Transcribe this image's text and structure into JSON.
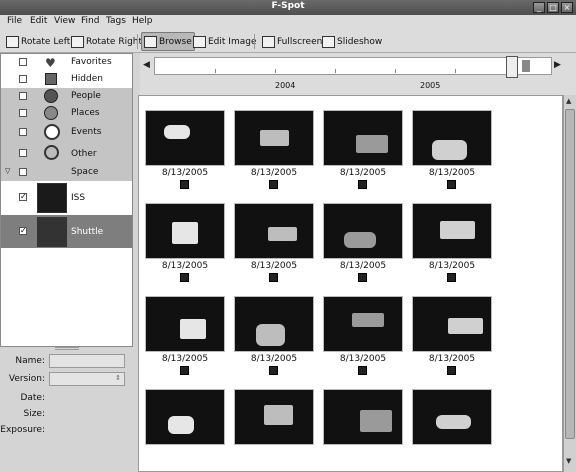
{
  "window": {
    "title": "F-Spot"
  },
  "menubar": [
    "File",
    "Edit",
    "View",
    "Find",
    "Tags",
    "Help"
  ],
  "toolbar": {
    "rotate_left": "Rotate Left",
    "rotate_right": "Rotate Right",
    "browse": "Browse",
    "edit_image": "Edit Image",
    "fullscreen": "Fullscreen",
    "slideshow": "Slideshow"
  },
  "tags": [
    {
      "label": "Favorites",
      "icon": "heart-icon",
      "checked": false
    },
    {
      "label": "Hidden",
      "icon": "lock-icon",
      "checked": false
    },
    {
      "label": "People",
      "icon": "people-icon",
      "checked": false
    },
    {
      "label": "Places",
      "icon": "globe-icon",
      "checked": false
    },
    {
      "label": "Events",
      "icon": "clock-icon",
      "checked": false
    },
    {
      "label": "Other",
      "icon": "other-icon",
      "checked": false
    },
    {
      "label": "Space",
      "icon": "",
      "checked": false
    },
    {
      "label": "ISS",
      "icon": "iss-thumb",
      "checked": true
    },
    {
      "label": "Shuttle",
      "icon": "shuttle-thumb",
      "checked": true
    }
  ],
  "info": {
    "name_label": "Name:",
    "version_label": "Version:",
    "date_label": "Date:",
    "size_label": "Size:",
    "exposure_label": "Exposure:"
  },
  "timeline": {
    "years": [
      "2004",
      "2005"
    ]
  },
  "photos": [
    {
      "date": "8/13/2005"
    },
    {
      "date": "8/13/2005"
    },
    {
      "date": "8/13/2005"
    },
    {
      "date": "8/13/2005"
    },
    {
      "date": "8/13/2005"
    },
    {
      "date": "8/13/2005"
    },
    {
      "date": "8/13/2005"
    },
    {
      "date": "8/13/2005"
    },
    {
      "date": "8/13/2005"
    },
    {
      "date": "8/13/2005"
    },
    {
      "date": "8/13/2005"
    },
    {
      "date": "8/13/2005"
    },
    {
      "date": ""
    },
    {
      "date": ""
    },
    {
      "date": ""
    },
    {
      "date": ""
    }
  ]
}
